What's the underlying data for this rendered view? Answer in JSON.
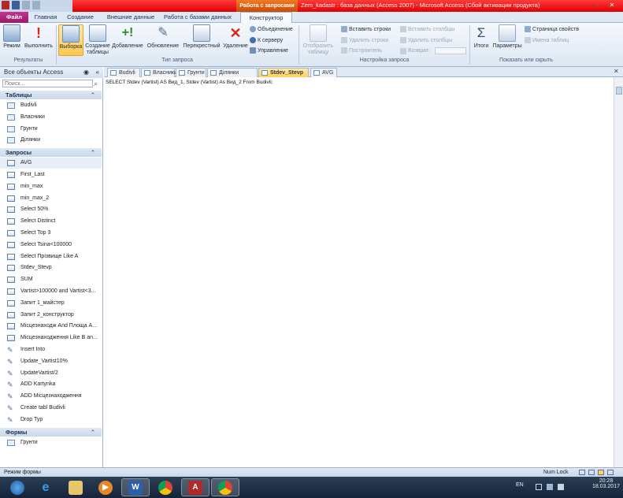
{
  "titlebar": {
    "context_badge": "Работа с запросами",
    "title": "Zem_kadastr : база данных (Access 2007) - Microsoft Access (Сбой активации продукта)"
  },
  "tabs": [
    "Файл",
    "Главная",
    "Создание",
    "Внешние данные",
    "Работа с базами данных",
    "Конструктор"
  ],
  "ribbon": {
    "results": {
      "label": "Результаты",
      "mode": "Режим",
      "run": "Выполнить"
    },
    "query_type": {
      "label": "Тип запроса",
      "select": "Выборка",
      "make_table": "Создание таблицы",
      "append": "Добавление",
      "update": "Обновление",
      "crosstab": "Перекрестный",
      "delete": "Удаление",
      "union": "Объединение",
      "pass_through": "К серверу",
      "data_def": "Управление"
    },
    "setup": {
      "label": "Настройка запроса",
      "show_table": "Отобразить таблицу",
      "insert_rows": "Вставить строки",
      "delete_rows": "Удалить строки",
      "builder": "Построитель",
      "insert_cols": "Вставить столбцы",
      "delete_cols": "Удалить столбцы",
      "return": "Возврат:"
    },
    "show_hide": {
      "label": "Показать или скрыть",
      "totals": "Итоги",
      "params": "Параметры",
      "props": "Страница свойств",
      "table_names": "Имена таблиц"
    }
  },
  "nav": {
    "header": "Все объекты Access",
    "search_placeholder": "Поиск...",
    "groups": {
      "tables": "Таблицы",
      "queries": "Запросы",
      "forms": "Формы"
    },
    "tables": [
      "Budivli",
      "Власники",
      "Грунти",
      "Ділянки"
    ],
    "queries": [
      "AVG",
      "First_Last",
      "min_max",
      "min_max_2",
      "Select 50%",
      "Select Distinct",
      "Select Top 3",
      "Select Tsina<100000",
      "Select Прізвище Like A",
      "Stdev_Stevp",
      "SUM",
      "Vartist>100000 and Vartist<3...",
      "Запит 1_майстер",
      "Запит 2_конструктор",
      "Місцезнаходж And Площа A...",
      "Місцезнаходження Like B an...",
      "Insert Into",
      "Update_Vartist10%",
      "UpdateVartist/2",
      "ADD Kartynka",
      "ADD Місцезнаходження",
      "Create tabl Budivli",
      "Drop Typ"
    ],
    "forms": [
      "Грунти"
    ]
  },
  "doctabs": [
    "Budivli",
    "Власники",
    "Грунти",
    "Ділянки",
    "Stdev_Stevp",
    "AVG"
  ],
  "sql": "SELECT Stdev (Vartist) AS Вид_1, Stdev (Vartist) As Вид_2 From Budivli;",
  "statusbar": {
    "left": "Режим формы",
    "numlock": "Num Lock"
  },
  "taskbar": {
    "lang": "EN",
    "time": "20:28",
    "date": "18.03.2017"
  }
}
